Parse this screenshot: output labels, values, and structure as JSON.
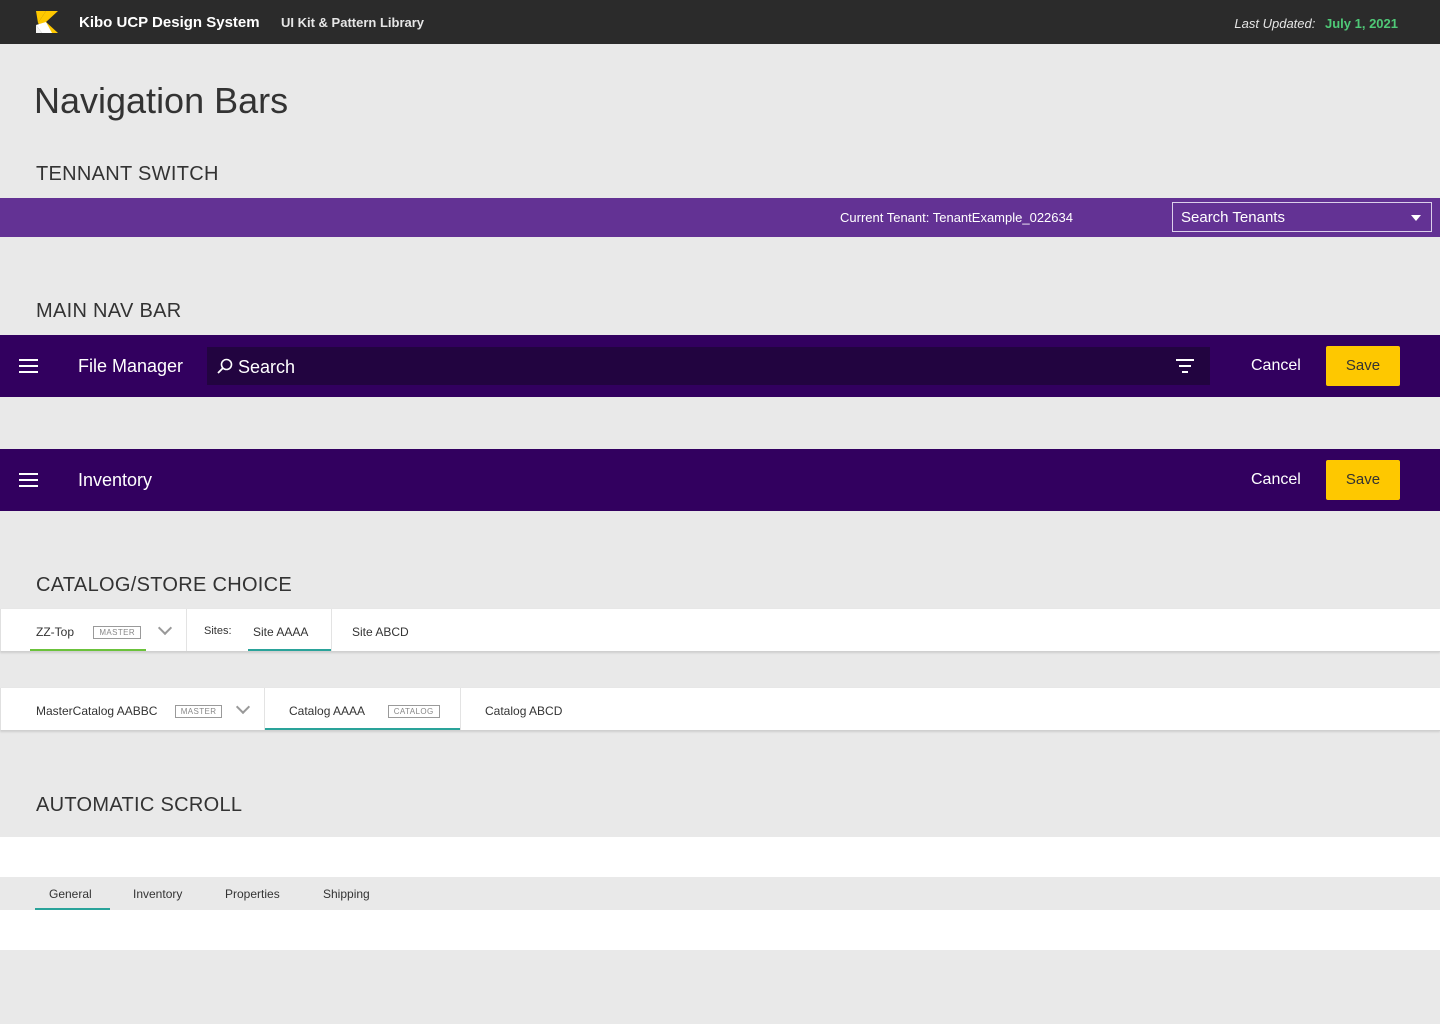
{
  "header": {
    "brand": "Kibo UCP Design System",
    "subtitle": "UI Kit & Pattern Library",
    "last_updated_label": "Last Updated:",
    "last_updated_date": "July 1, 2021",
    "logo_color": "#fec800"
  },
  "page_title": "Navigation Bars",
  "sections": {
    "tenant": "TENNANT SWITCH",
    "main_nav": "MAIN NAV BAR",
    "catalog": "CATALOG/STORE CHOICE",
    "scroll": "AUTOMATIC SCROLL"
  },
  "tenant_bar": {
    "current_tenant": "Current Tenant: TenantExample_022634",
    "search_placeholder": "Search Tenants"
  },
  "navbar1": {
    "title": "File Manager",
    "search_placeholder": "Search",
    "cancel_label": "Cancel",
    "save_label": "Save"
  },
  "navbar2": {
    "title": "Inventory",
    "cancel_label": "Cancel",
    "save_label": "Save"
  },
  "store_bar": {
    "store": "ZZ-Top",
    "store_badge": "MASTER",
    "sites_label": "Sites:",
    "sites": [
      "Site AAAA",
      "Site ABCD"
    ]
  },
  "catalog_bar": {
    "catalog": "MasterCatalog AABBC",
    "catalog_badge": "MASTER",
    "selected": "Catalog AAAA",
    "selected_badge": "CATALOG",
    "other": "Catalog ABCD"
  },
  "scroll_tabs": [
    "General",
    "Inventory",
    "Properties",
    "Shipping"
  ],
  "colors": {
    "topbar": "#2b2b2b",
    "tenant_purple": "#633294",
    "nav_purple": "#32005f",
    "save_yellow": "#fec800",
    "accent_green": "#6bc23b",
    "accent_teal": "#2aa39a"
  }
}
